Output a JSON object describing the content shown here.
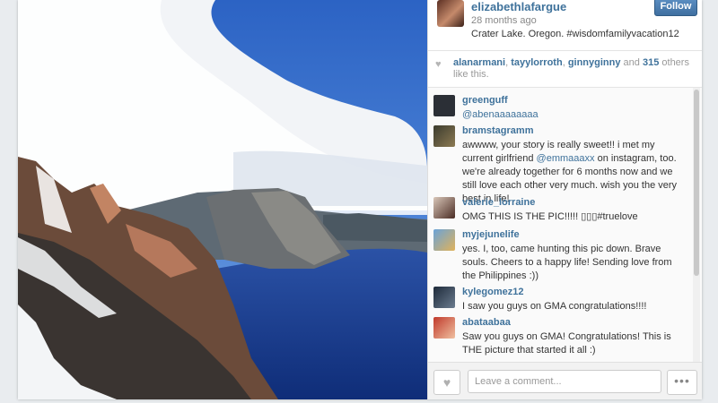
{
  "post": {
    "username": "elizabethlafargue",
    "time": "28 months ago",
    "caption": "Crater Lake. Oregon. #wisdomfamilyvacation12",
    "follow_label": "Follow"
  },
  "likes": {
    "names": [
      "alanarmani",
      "tayylorroth",
      "ginnyginny"
    ],
    "connector": "and",
    "others_count": "315",
    "others_suffix": "others like this."
  },
  "comments": [
    {
      "user": "greenguff",
      "mention": "@abenaaaaaaaa",
      "text": ""
    },
    {
      "user": "bramstagramm",
      "text_before": "awwww, your story is really sweet!! i met my current girlfriend",
      "mention": "@emmaaaxx",
      "text_after": "on instagram, too. we're already together for 6 months now and we still love each other very much. wish you the very best in life!"
    },
    {
      "user": "valerie_lorraine",
      "text": "OMG THIS IS THE PIC!!!!! ▯▯▯#truelove"
    },
    {
      "user": "myjejunelife",
      "text": "yes. I, too, came hunting this pic down. Brave souls. Cheers to a happy life! Sending love from the Philippines :))"
    },
    {
      "user": "kylegomez12",
      "text": "I saw you guys on GMA congratulations!!!!"
    },
    {
      "user": "abataabaa",
      "text": "Saw you guys on GMA! Congratulations! This is THE picture that started it all :)"
    }
  ],
  "footer": {
    "comment_placeholder": "Leave a comment...",
    "more_label": "•••"
  },
  "icons": {
    "heart": "heart-icon",
    "more": "ellipsis-icon"
  },
  "colors": {
    "link": "#3f729b",
    "follow_button": "#4f81b4"
  }
}
